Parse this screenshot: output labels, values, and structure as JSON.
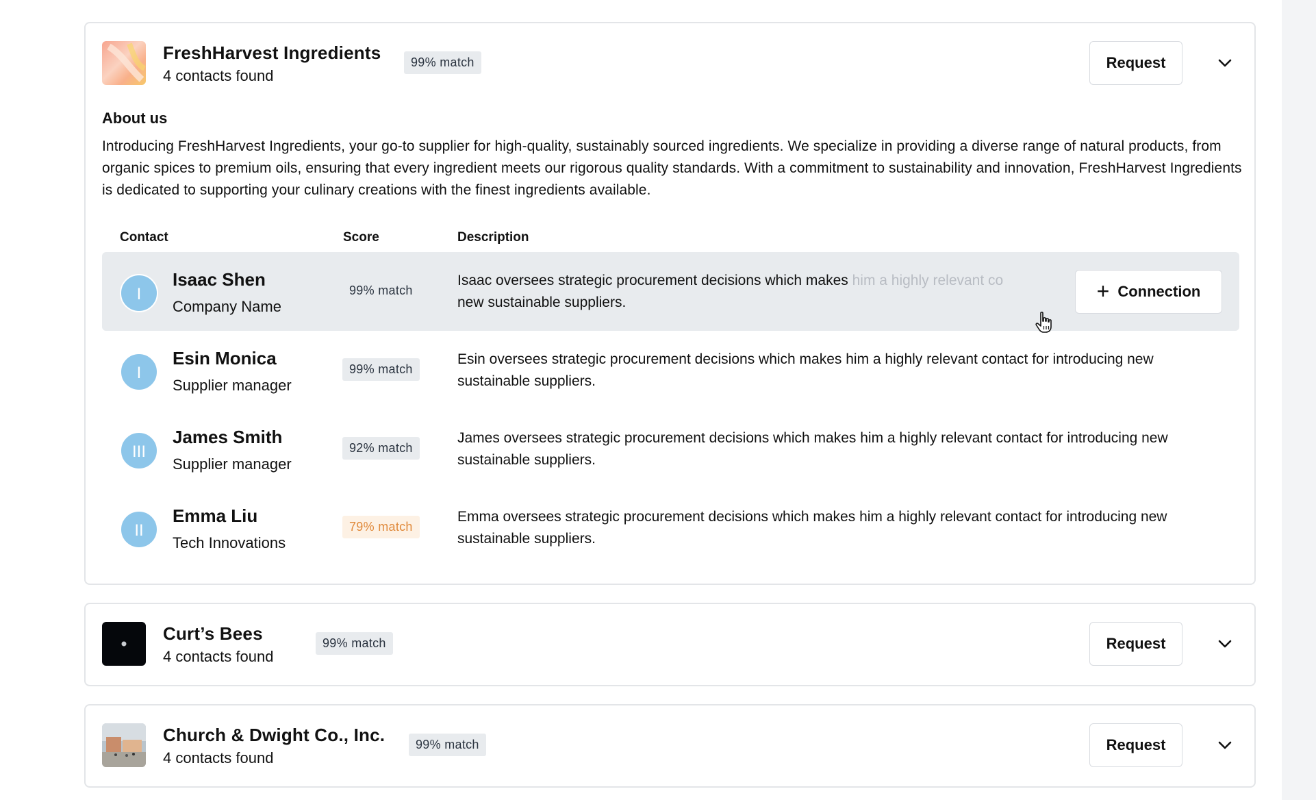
{
  "companies": [
    {
      "name": "FreshHarvest Ingredients",
      "contacts_found": "4 contacts found",
      "match": "99% match",
      "request_label": "Request",
      "about_title": "About us",
      "about_text": "Introducing FreshHarvest Ingredients, your go-to supplier for high-quality, sustainably sourced ingredients. We specialize in providing a diverse range of natural products, from organic spices to premium oils, ensuring that every ingredient meets our rigorous quality standards. With a commitment to sustainability and innovation, FreshHarvest Ingredients is dedicated to supporting your culinary creations with the finest ingredients available.",
      "table": {
        "headers": {
          "contact": "Contact",
          "score": "Score",
          "description": "Description"
        },
        "rows": [
          {
            "initial": "I",
            "name": "Isaac Shen",
            "role": "Company Name",
            "score": "99% match",
            "desc_visible": "Isaac oversees strategic procurement decisions which makes ",
            "desc_faded": "him a highly relevant co",
            "desc_line2": "new sustainable suppliers.",
            "action_label": "Connection",
            "hovered": true
          },
          {
            "initial": "I",
            "name": "Esin Monica",
            "role": "Supplier manager",
            "score": "99% match",
            "description": "Esin oversees strategic procurement decisions which makes him a highly relevant contact for introducing new sustainable suppliers."
          },
          {
            "initial": "III",
            "name": "James Smith",
            "role": "Supplier manager",
            "score": "92% match",
            "description": "James oversees strategic procurement decisions which makes him a highly relevant contact for introducing new sustainable suppliers."
          },
          {
            "initial": "II",
            "name": "Emma Liu",
            "role": "Tech Innovations",
            "score": "79% match",
            "score_status": "warning",
            "description": "Emma oversees strategic procurement decisions which makes him a highly relevant contact for introducing new sustainable suppliers."
          }
        ]
      }
    },
    {
      "name": "Curt’s Bees",
      "contacts_found": "4 contacts found",
      "match": "99% match",
      "request_label": "Request"
    },
    {
      "name": "Church & Dwight Co., Inc.",
      "contacts_found": "4 contacts found",
      "match": "99% match",
      "request_label": "Request"
    }
  ],
  "icons": {
    "expand": "chevron-down-icon",
    "add": "plus-icon",
    "cursor": "hand-pointer-icon"
  },
  "colors": {
    "badge_bg": "#e8ebee",
    "warn_text": "#e08a3c",
    "warn_bg": "#fdf1e4",
    "avatar": "#8dc6ea",
    "hover_row": "#e8ebee",
    "border": "#e3e5e8"
  }
}
